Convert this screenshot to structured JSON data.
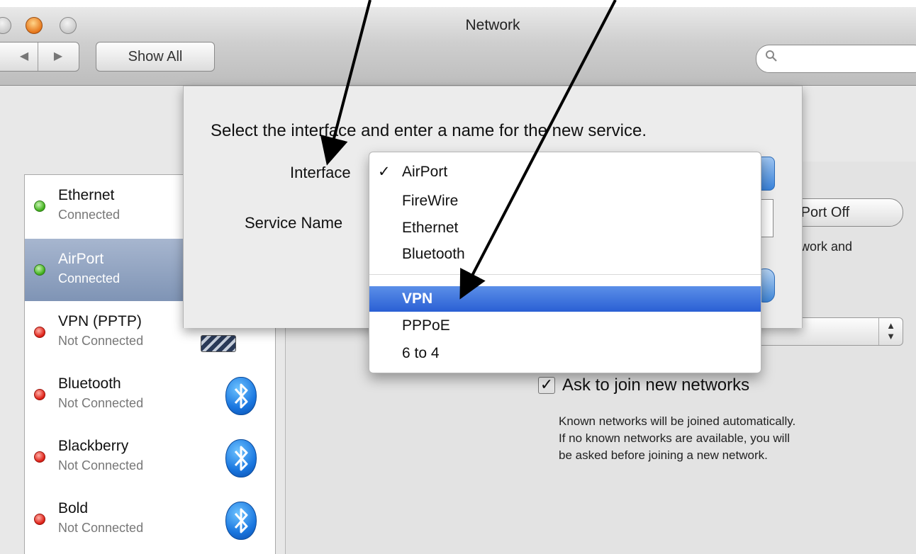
{
  "window": {
    "title": "Network",
    "nav": {
      "back": "◀",
      "forward": "▶"
    },
    "show_all": "Show All",
    "search_icon": "magnifier-icon"
  },
  "sidebar": {
    "services": [
      {
        "name": "Ethernet",
        "status": "Connected",
        "status_color": "green",
        "icon": "ethernet-icon"
      },
      {
        "name": "AirPort",
        "status": "Connected",
        "status_color": "green",
        "icon": "airport-icon",
        "selected": true
      },
      {
        "name": "VPN (PPTP)",
        "status": "Not Connected",
        "status_color": "red",
        "icon": "vpn-icon"
      },
      {
        "name": "Bluetooth",
        "status": "Not Connected",
        "status_color": "red",
        "icon": "bluetooth-icon"
      },
      {
        "name": "Blackberry",
        "status": "Not Connected",
        "status_color": "red",
        "icon": "bluetooth-icon"
      },
      {
        "name": "Bold",
        "status": "Not Connected",
        "status_color": "red",
        "icon": "bluetooth-icon"
      }
    ]
  },
  "panel": {
    "airport_off_button": "rPort Off",
    "fragment_text": "twork and",
    "popup_arrows": "▲▼",
    "ask_checkbox": {
      "label": "Ask to join new networks",
      "checked": true
    },
    "help_lines": [
      "Known networks will be joined automatically.",
      "If no known networks are available, you will",
      "be asked before joining a new network."
    ]
  },
  "sheet": {
    "prompt": "Select the interface and enter a name for the new service.",
    "interface_label": "Interface",
    "service_name_label": "Service Name"
  },
  "menu": {
    "items": [
      {
        "label": "AirPort",
        "checked": true,
        "check_mark": "✓"
      },
      {
        "label": "FireWire"
      },
      {
        "label": "Ethernet"
      },
      {
        "label": "Bluetooth"
      },
      {
        "label": "VPN",
        "highlighted": true
      },
      {
        "label": "PPPoE"
      },
      {
        "label": "6 to 4"
      }
    ]
  },
  "colors": {
    "selection_blue": "#2a5fd4",
    "sidebar_selected": "#7f94b5",
    "status_green": "#44b31f",
    "status_red": "#e0241a",
    "bluetooth_blue": "#1a77e0"
  }
}
